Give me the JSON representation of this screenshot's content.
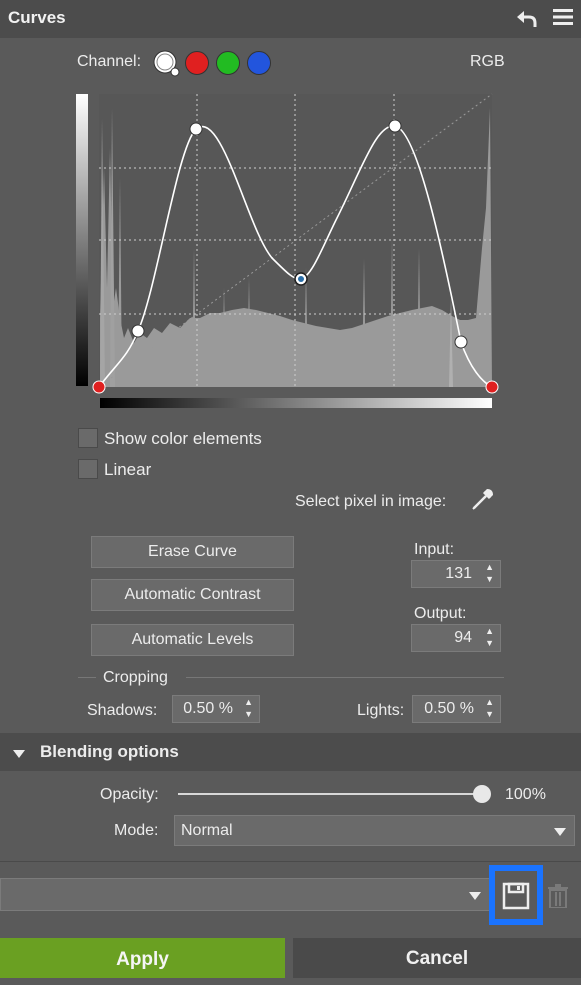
{
  "panel": {
    "title": "Curves"
  },
  "channel": {
    "label": "Channel:",
    "selected": "RGB",
    "options": [
      "white",
      "red",
      "green",
      "blue"
    ],
    "colors": {
      "white": "#ffffff",
      "red": "#e02020",
      "green": "#22bb22",
      "blue": "#2255dd"
    }
  },
  "options": {
    "show_color_elements": "Show color elements",
    "linear": "Linear",
    "select_pixel": "Select pixel in image:"
  },
  "buttons": {
    "erase_curve": "Erase Curve",
    "automatic_contrast": "Automatic Contrast",
    "automatic_levels": "Automatic Levels"
  },
  "input": {
    "label": "Input:",
    "value": "131"
  },
  "output": {
    "label": "Output:",
    "value": "94"
  },
  "cropping": {
    "title": "Cropping",
    "shadows_label": "Shadows:",
    "shadows_value": "0.50 %",
    "lights_label": "Lights:",
    "lights_value": "0.50 %"
  },
  "blending": {
    "title": "Blending options",
    "opacity_label": "Opacity:",
    "opacity_value": "100%",
    "opacity_level": 1.0,
    "mode_label": "Mode:",
    "mode_value": "Normal"
  },
  "preset": {
    "value": ""
  },
  "footer": {
    "apply": "Apply",
    "cancel": "Cancel"
  },
  "accent": "#6aa022",
  "highlight": "#1a73ff"
}
